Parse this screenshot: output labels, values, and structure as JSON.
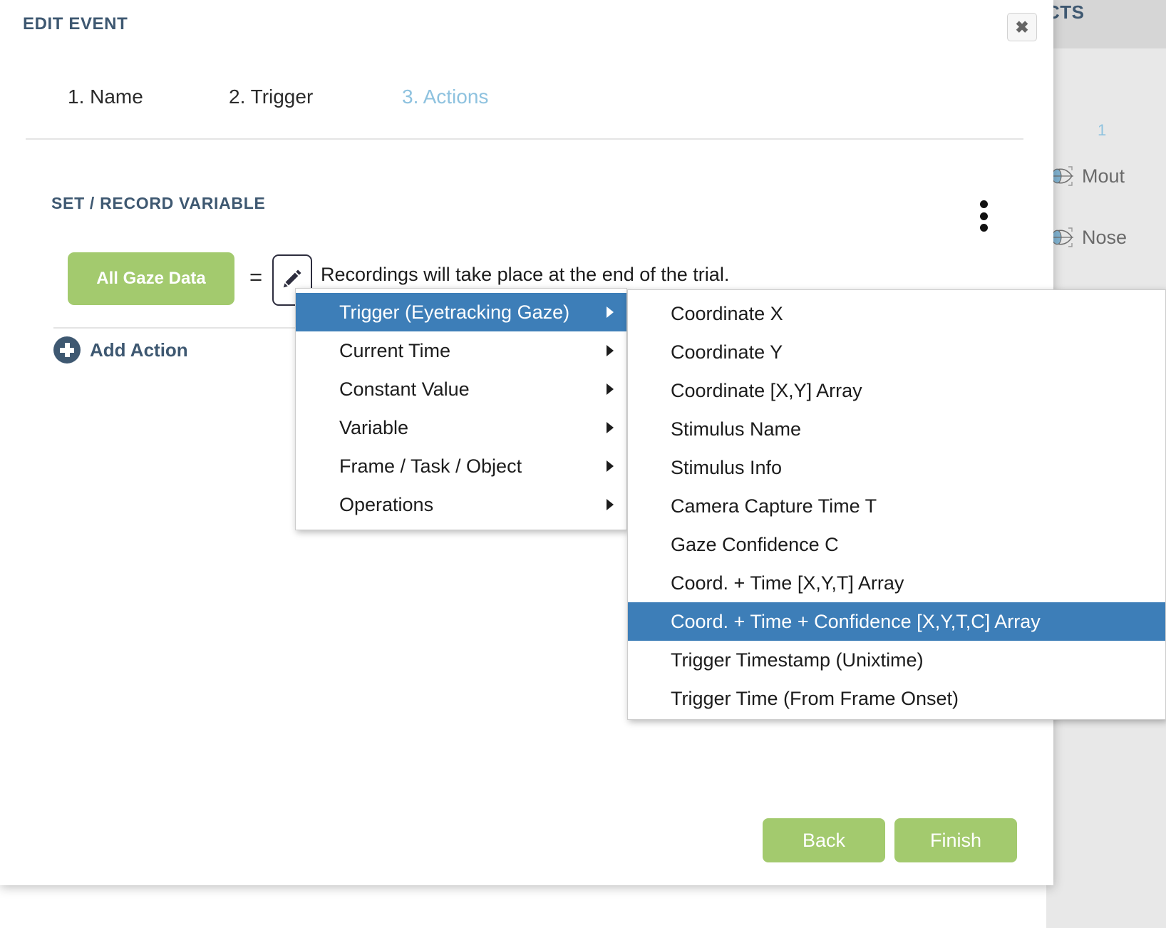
{
  "background_panel": {
    "title": "CTS",
    "count_label": "1",
    "items": [
      {
        "label": "Mout",
        "icon": "eye-aoi-icon"
      },
      {
        "label": "Nose",
        "icon": "eye-aoi-icon"
      }
    ]
  },
  "modal": {
    "title": "EDIT EVENT",
    "close_label": "✖",
    "steps": [
      {
        "label": "1. Name",
        "active": false
      },
      {
        "label": "2. Trigger",
        "active": false
      },
      {
        "label": "3. Actions",
        "active": true
      }
    ],
    "section": {
      "heading": "SET / RECORD VARIABLE",
      "kebab_icon": "vertical-dots-icon"
    },
    "action_row": {
      "variable_label": "All Gaze Data",
      "equals": "=",
      "edit_icon": "pencil-icon",
      "description": "Recordings will take place at the end of the trial."
    },
    "add_action_label": "Add Action",
    "footer": {
      "back_label": "Back",
      "finish_label": "Finish"
    }
  },
  "context_menu": {
    "level1": [
      {
        "label": "Trigger (Eyetracking Gaze)",
        "selected": true,
        "has_submenu": true
      },
      {
        "label": "Current Time",
        "selected": false,
        "has_submenu": true
      },
      {
        "label": "Constant Value",
        "selected": false,
        "has_submenu": true
      },
      {
        "label": "Variable",
        "selected": false,
        "has_submenu": true
      },
      {
        "label": "Frame / Task / Object",
        "selected": false,
        "has_submenu": true
      },
      {
        "label": "Operations",
        "selected": false,
        "has_submenu": true
      }
    ],
    "level2": [
      {
        "label": "Coordinate X",
        "selected": false
      },
      {
        "label": "Coordinate Y",
        "selected": false
      },
      {
        "label": "Coordinate [X,Y] Array",
        "selected": false
      },
      {
        "label": "Stimulus Name",
        "selected": false
      },
      {
        "label": "Stimulus Info",
        "selected": false
      },
      {
        "label": "Camera Capture Time T",
        "selected": false
      },
      {
        "label": "Gaze Confidence C",
        "selected": false
      },
      {
        "label": "Coord. + Time [X,Y,T] Array",
        "selected": false
      },
      {
        "label": "Coord. + Time + Confidence [X,Y,T,C] Array",
        "selected": true
      },
      {
        "label": "Trigger Timestamp (Unixtime)",
        "selected": false
      },
      {
        "label": "Trigger Time (From Frame Onset)",
        "selected": false
      }
    ]
  },
  "colors": {
    "accent_blue": "#3d7eb8",
    "brand_navy": "#3e5871",
    "green_button": "#a3ca6e",
    "step_active": "#8ec2df"
  }
}
